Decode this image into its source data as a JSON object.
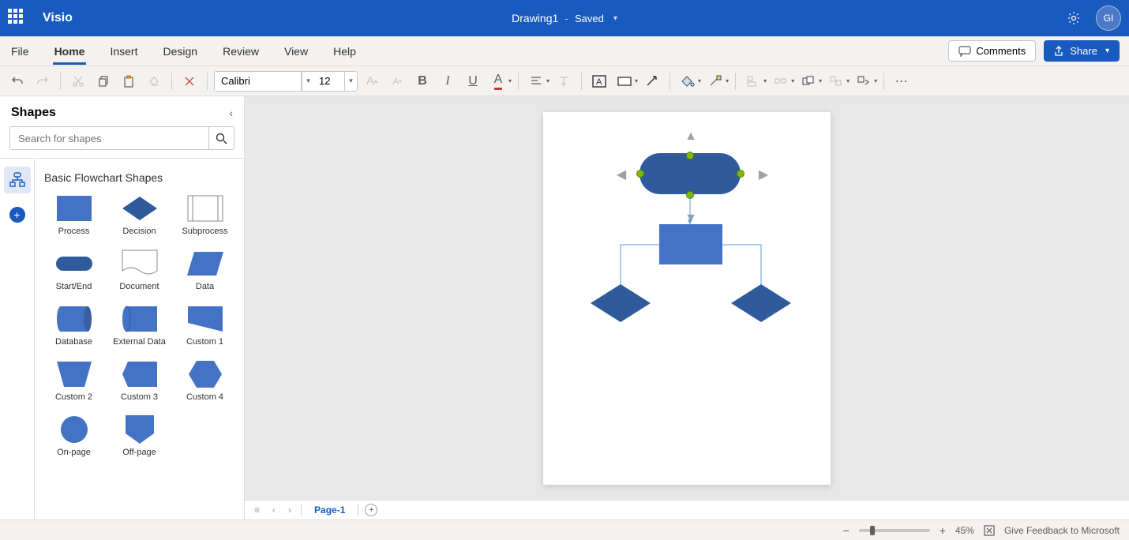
{
  "app": {
    "name": "Visio"
  },
  "document": {
    "name": "Drawing1",
    "separator": "-",
    "status": "Saved"
  },
  "user": {
    "initials": "GI"
  },
  "menubar": {
    "tabs": [
      "File",
      "Home",
      "Insert",
      "Design",
      "Review",
      "View",
      "Help"
    ],
    "active_index": 1,
    "comments": "Comments",
    "share": "Share"
  },
  "ribbon": {
    "font_name": "Calibri",
    "font_size": "12"
  },
  "shapes_panel": {
    "title": "Shapes",
    "search_placeholder": "Search for shapes",
    "stencil_title": "Basic Flowchart Shapes",
    "shapes": [
      {
        "label": "Process"
      },
      {
        "label": "Decision"
      },
      {
        "label": "Subprocess"
      },
      {
        "label": "Start/End"
      },
      {
        "label": "Document"
      },
      {
        "label": "Data"
      },
      {
        "label": "Database"
      },
      {
        "label": "External Data"
      },
      {
        "label": "Custom 1"
      },
      {
        "label": "Custom 2"
      },
      {
        "label": "Custom 3"
      },
      {
        "label": "Custom 4"
      },
      {
        "label": "On-page"
      },
      {
        "label": "Off-page"
      }
    ]
  },
  "page_tabs": {
    "current": "Page-1"
  },
  "statusbar": {
    "zoom": "45%",
    "feedback": "Give Feedback to Microsoft"
  },
  "colors": {
    "brand": "#185abd",
    "shape_fill": "#2f5b9c",
    "shape_fill2": "#4472c4"
  }
}
